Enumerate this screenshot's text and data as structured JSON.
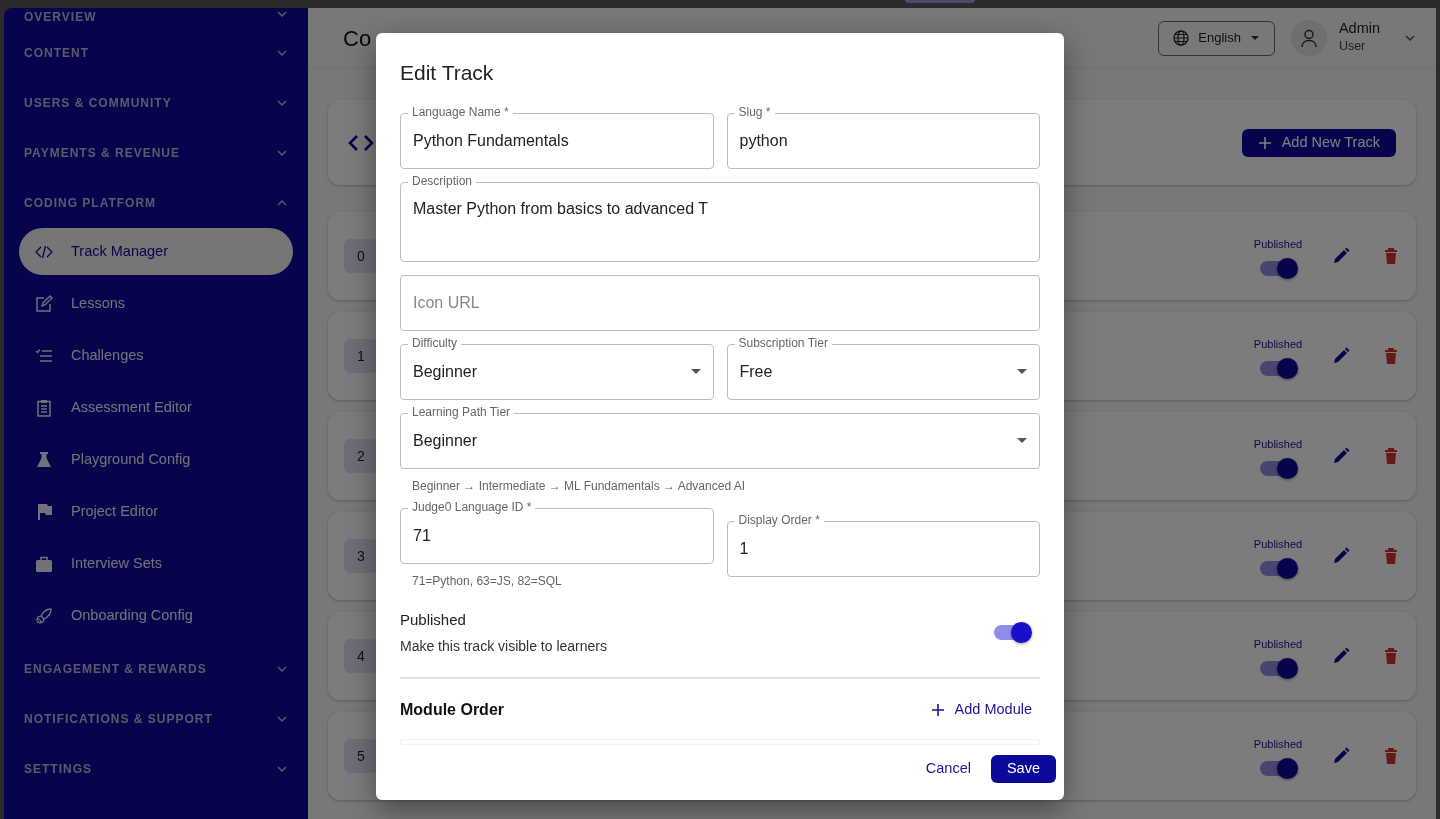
{
  "sidebar": {
    "sections": [
      {
        "label": "OVERVIEW",
        "expanded": false
      },
      {
        "label": "CONTENT",
        "expanded": false
      },
      {
        "label": "USERS & COMMUNITY",
        "expanded": false
      },
      {
        "label": "PAYMENTS & REVENUE",
        "expanded": false
      },
      {
        "label": "CODING PLATFORM",
        "expanded": true,
        "items": [
          {
            "label": "Track Manager",
            "selected": true
          },
          {
            "label": "Lessons",
            "selected": false
          },
          {
            "label": "Challenges",
            "selected": false
          },
          {
            "label": "Assessment Editor",
            "selected": false
          },
          {
            "label": "Playground Config",
            "selected": false
          },
          {
            "label": "Project Editor",
            "selected": false
          },
          {
            "label": "Interview Sets",
            "selected": false
          },
          {
            "label": "Onboarding Config",
            "selected": false
          }
        ]
      },
      {
        "label": "ENGAGEMENT & REWARDS",
        "expanded": false
      },
      {
        "label": "NOTIFICATIONS & SUPPORT",
        "expanded": false
      },
      {
        "label": "SETTINGS",
        "expanded": false
      }
    ]
  },
  "header": {
    "title": "Co",
    "language": "English",
    "user_name": "Admin",
    "user_role": "User"
  },
  "toolbar": {
    "add_button": "Add New Track"
  },
  "tracks": [
    {
      "order": "0",
      "status_label": "Published",
      "published": true
    },
    {
      "order": "1",
      "status_label": "Published",
      "published": true
    },
    {
      "order": "2",
      "status_label": "Published",
      "published": true
    },
    {
      "order": "3",
      "status_label": "Published",
      "published": true
    },
    {
      "order": "4",
      "status_label": "Published",
      "published": true
    },
    {
      "order": "5",
      "status_label": "Published",
      "published": true
    }
  ],
  "dialog": {
    "title": "Edit Track",
    "rows": [
      [
        {
          "kind": "text",
          "label": "Language Name *",
          "value": "Python Fundamentals"
        },
        {
          "kind": "text",
          "label": "Slug *",
          "value": "python"
        }
      ],
      [
        {
          "kind": "textarea",
          "label": "Description",
          "value": "Master Python from basics to advanced T"
        }
      ],
      [
        {
          "kind": "text",
          "placeholder": "Icon URL"
        }
      ],
      [
        {
          "kind": "select",
          "label": "Difficulty",
          "value": "Beginner"
        },
        {
          "kind": "select",
          "label": "Subscription Tier",
          "value": "Free"
        }
      ],
      [
        {
          "kind": "select",
          "label": "Learning Path Tier",
          "value": "Beginner",
          "helper": "Beginner → Intermediate → ML Fundamentals → Advanced AI"
        }
      ],
      [
        {
          "kind": "text",
          "label": "Judge0 Language ID *",
          "value": "71",
          "helper": "71=Python, 63=JS, 82=SQL"
        },
        {
          "kind": "text",
          "label": "Display Order *",
          "value": "1"
        }
      ]
    ],
    "publish": {
      "title": "Published",
      "description": "Make this track visible to learners",
      "on": true
    },
    "modules": {
      "title": "Module Order",
      "add_link": "Add Module"
    },
    "buttons": [
      {
        "label": "Cancel",
        "kind": "text"
      },
      {
        "label": "Save",
        "kind": "contained"
      }
    ]
  }
}
